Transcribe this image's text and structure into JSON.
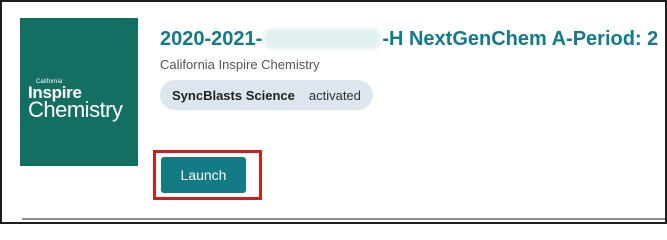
{
  "course": {
    "title_prefix": "2020-2021-",
    "title_suffix": "-H NextGenChem A-Period: 2",
    "program": "California Inspire Chemistry"
  },
  "cover": {
    "state": "California",
    "brand": "Inspire",
    "subject": "Chemistry",
    "background_color": "#146f63"
  },
  "badge": {
    "name": "SyncBlasts Science",
    "status": "activated"
  },
  "actions": {
    "launch_label": "Launch"
  },
  "colors": {
    "accent": "#127b86",
    "highlight": "#d51b1b"
  }
}
